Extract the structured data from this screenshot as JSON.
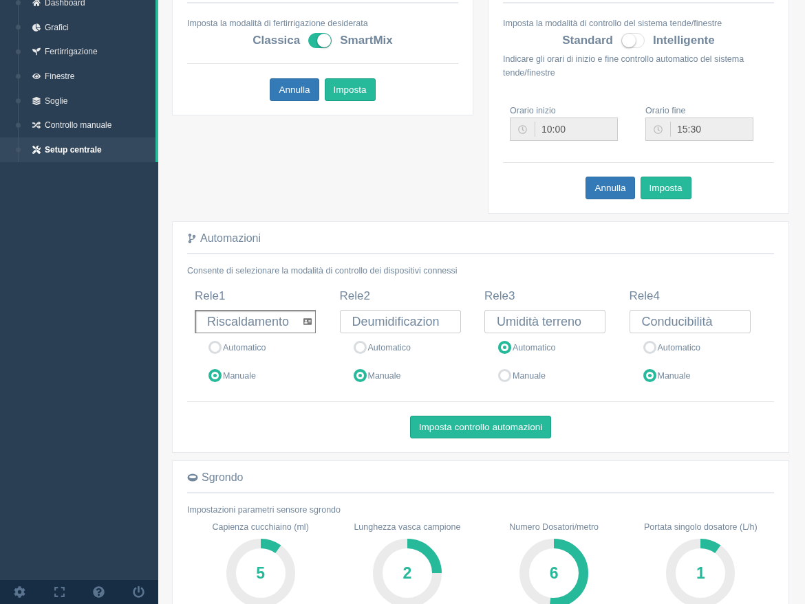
{
  "sidebar": {
    "items": [
      {
        "label": "Dashboard",
        "selected": false
      },
      {
        "label": "Grafici",
        "selected": false
      },
      {
        "label": "Fertirrigazione",
        "selected": false
      },
      {
        "label": "Finestre",
        "selected": false
      },
      {
        "label": "Soglie",
        "selected": false
      },
      {
        "label": "Controllo manuale",
        "selected": false
      },
      {
        "label": "Setup centrale",
        "selected": true
      }
    ]
  },
  "fertirrigazione": {
    "description": "Imposta la modalità di fertirrigazione desiderata",
    "toggle": {
      "left": "Classica",
      "right": "SmartMix",
      "on": true
    },
    "buttons": [
      {
        "label": "Annulla",
        "kind": "cancel"
      },
      {
        "label": "Imposta",
        "kind": "confirm"
      }
    ]
  },
  "finestre": {
    "description": "Imposta la modalità di controllo del sistema tende/finestre",
    "toggle": {
      "left": "Standard",
      "right": "Intelligente",
      "on": false
    },
    "hint": "Indicare gli orari di inizio e fine controllo automatico del sistema tende/finestre",
    "times": [
      {
        "label": "Orario inizio",
        "value": "10:00"
      },
      {
        "label": "Orario fine",
        "value": "15:30"
      }
    ],
    "buttons": [
      {
        "label": "Annulla",
        "kind": "cancel"
      },
      {
        "label": "Imposta",
        "kind": "confirm"
      }
    ]
  },
  "automazioni": {
    "title": "Automazioni",
    "description": "Consente di selezionare la modalità di controllo dei dispositivi connessi",
    "relays": [
      {
        "name": "Rele1",
        "value": "Riscaldamento",
        "focused": true,
        "options": [
          {
            "label": "Automatico",
            "selected": false
          },
          {
            "label": "Manuale",
            "selected": true
          }
        ]
      },
      {
        "name": "Rele2",
        "value": "Deumidificazion",
        "focused": false,
        "options": [
          {
            "label": "Automatico",
            "selected": false
          },
          {
            "label": "Manuale",
            "selected": true
          }
        ]
      },
      {
        "name": "Rele3",
        "value": "Umidità terreno",
        "focused": false,
        "options": [
          {
            "label": "Automatico",
            "selected": true
          },
          {
            "label": "Manuale",
            "selected": false
          }
        ]
      },
      {
        "name": "Rele4",
        "value": "Conducibilità",
        "focused": false,
        "options": [
          {
            "label": "Automatico",
            "selected": false
          },
          {
            "label": "Manuale",
            "selected": true
          }
        ]
      }
    ],
    "button": "Imposta controllo automazioni"
  },
  "sgrondo": {
    "title": "Sgrondo",
    "description": "Impostazioni parametri sensore sgrondo",
    "gauges": [
      {
        "label": "Capienza cucchiaino (ml)",
        "value": "5",
        "level": 0.1
      },
      {
        "label": "Lunghezza vasca campione",
        "value": "2",
        "level": 0.25
      },
      {
        "label": "Numero Dosatori/metro",
        "value": "6",
        "level": 0.52
      },
      {
        "label": "Portata singolo dosatore (L/h)",
        "value": "1",
        "level": 0.1
      }
    ]
  }
}
